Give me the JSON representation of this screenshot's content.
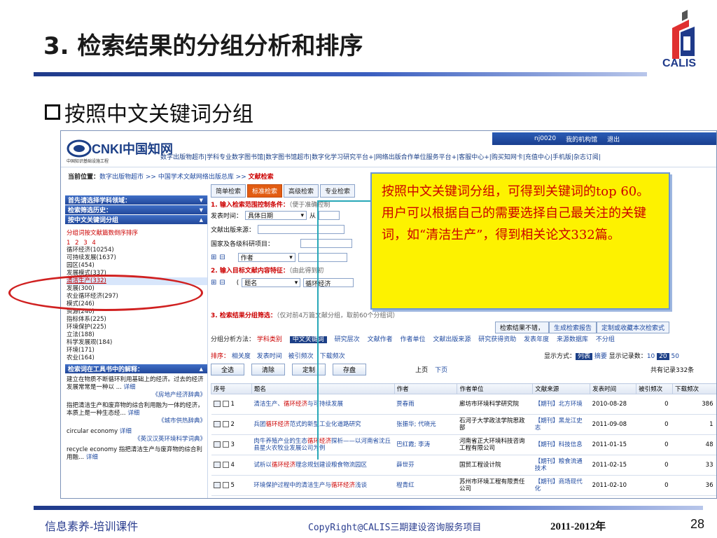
{
  "slide": {
    "title": "3. 检索结果的分组分析和排序",
    "bullet": "按照中文关键词分组",
    "logo_text": "CALIS",
    "footer_left": "信息素养-培训课件",
    "footer_mid": "CopyRight@CALIS三期建设咨询服务项目",
    "footer_year": "2011-2012年",
    "page_number": "28",
    "callout": "按照中文关键词分组，可得到关键词的top 60。用户可以根据自己的需要选择自己最关注的关键词，如“清洁生产”，得到相关论文332篇。"
  },
  "cnki": {
    "logo": "CNKI中国知网",
    "logo_sub": "中国知识基础设施工程",
    "topbar": [
      "nj0020",
      "我的机构馆",
      "退出"
    ],
    "service_links": "数字出版物超市|学科专业数字图书馆|数字图书馆超市|数字化学习研究平台+|网络出版合作单位服务平台+|客服中心+|购买知网卡|充值中心|手机版|杂志订阅|",
    "crumb_label": "当前位置：",
    "crumb_path": "数字出版物超市 >> 中国学术文献网络出版总库 >>",
    "crumb_current": "文献检索"
  },
  "left": {
    "heads": [
      "首先请选择学科领域：",
      "检索筛选历史：",
      "按中文关键词分组"
    ],
    "note": "分组词按文献篇数倒序排序",
    "pages": "1 2 3 4",
    "keywords": [
      "循环经济(10254)",
      "可持续发展(1637)",
      "园区(454)",
      "发展模式(337)",
      "清洁生产(332)",
      "发展(300)",
      "农业循环经济(297)",
      "模式(246)",
      "资源(240)",
      "指标体系(225)",
      "环境保护(225)",
      "立法(188)",
      "科学发展观(184)",
      "环境(171)",
      "农业(164)"
    ],
    "tool_head": "检索词在工具书中的解释：",
    "defs": [
      {
        "text": "建立在物质不断循环利用基础上的经济。过去的经济发展常常是一种以 ... ",
        "link": "详细",
        "src": "《房地产经济辞典》"
      },
      {
        "text": "指把清洁生产和废弃物的综合利用融为一体的经济，本质上是一种生态经... ",
        "link": "详细",
        "src": "《城市供热辞典》"
      },
      {
        "text": "circular economy ",
        "link": "详细",
        "src": "《英汉汉英环境科学词典》"
      },
      {
        "text": "recycle economy 指把清洁生产与废弃物的综合利用融... ",
        "link": "详细",
        "src": ""
      }
    ]
  },
  "main": {
    "tabs": [
      "简单检索",
      "标准检索",
      "高级检索",
      "专业检索"
    ],
    "sec1": "1. 输入检索范围控制条件：",
    "sec1_hint": "（便于准确控制",
    "pub_time_label": "发表时间：",
    "pub_time_val": "具体日期",
    "from_label": "从",
    "source_label": "文献出版来源：",
    "fund_label": "国家及各级科研项目：",
    "author_sel": "作者",
    "sec2": "2. 输入目标文献内容特征：",
    "sec2_hint": "（由此得到初",
    "title_sel": "题名",
    "title_val": "循环经济",
    "sec3": "3. 检索结果分组筛选：",
    "sec3_hint": "（仅对前4万篇文献分组，取前60个分组词）",
    "tools": [
      "检索结果不错，",
      "生成检索报告",
      "定制或收藏本次检索式"
    ],
    "group_label": "分组分析方法：",
    "group_opts": [
      "学科类别",
      "中文关键词",
      "研究层次",
      "文献作者",
      "作者单位",
      "文献出版来源",
      "研究获得资助",
      "发表年度",
      "来源数据库",
      "不分组"
    ],
    "sort_label": "排序：",
    "sort_opts": [
      "相关度",
      "发表时间",
      "被引频次",
      "下载频次"
    ],
    "display_label": "显示方式：",
    "display_list": "列表",
    "display_summary": "摘要",
    "per_page_label": "显示记录数：",
    "per_page": [
      "10",
      "20",
      "50"
    ],
    "buttons": [
      "全选",
      "清除",
      "定制",
      "存盘"
    ],
    "pager": [
      "上页",
      "下页"
    ],
    "total": "共有记录332条",
    "columns": [
      "序号",
      "题名",
      "作者",
      "作者单位",
      "文献来源",
      "发表时间",
      "被引频次",
      "下载频次"
    ],
    "rows": [
      {
        "no": "1",
        "t1": "清洁生产、",
        "hl": "循环经济",
        "t2": "与可持续发展",
        "author": "贾春雨",
        "org": "廊坊市环境科学研究院",
        "src": "【期刊】北方环境",
        "date": "2010-08-28",
        "cited": "0",
        "dl": "386"
      },
      {
        "no": "2",
        "t1": "兵团",
        "hl": "循环经济",
        "t2": "范式的新型工业化道路研究",
        "author": "张振华; 代晓光",
        "org": "石河子大学政法学院思政部",
        "src": "【期刊】黑龙江史志",
        "date": "2011-09-08",
        "cited": "0",
        "dl": "1"
      },
      {
        "no": "3",
        "t1": "肉牛养殖产业的生态",
        "hl": "循环经济",
        "t2": "探析——以河南省沈丘县星火农牧业发展公司为例",
        "author": "巴红霞; 李涛",
        "org": "河南省正大环境科技咨询工程有限公司",
        "src": "【期刊】科技信息",
        "date": "2011-01-15",
        "cited": "0",
        "dl": "48"
      },
      {
        "no": "4",
        "t1": "试析以",
        "hl": "循环经济",
        "t2": "理念规划建设粮食物流园区",
        "author": "薛世芬",
        "org": "国贸工程设计院",
        "src": "【期刊】粮食流通技术",
        "date": "2011-02-15",
        "cited": "0",
        "dl": "33"
      },
      {
        "no": "5",
        "t1": "环境保护过程中的清洁生产与",
        "hl": "循环经济",
        "t2": "浅谈",
        "author": "程青红",
        "org": "苏州市环境工程有限责任公司",
        "src": "【期刊】商场现代化",
        "date": "2011-02-10",
        "cited": "0",
        "dl": "36"
      }
    ]
  }
}
